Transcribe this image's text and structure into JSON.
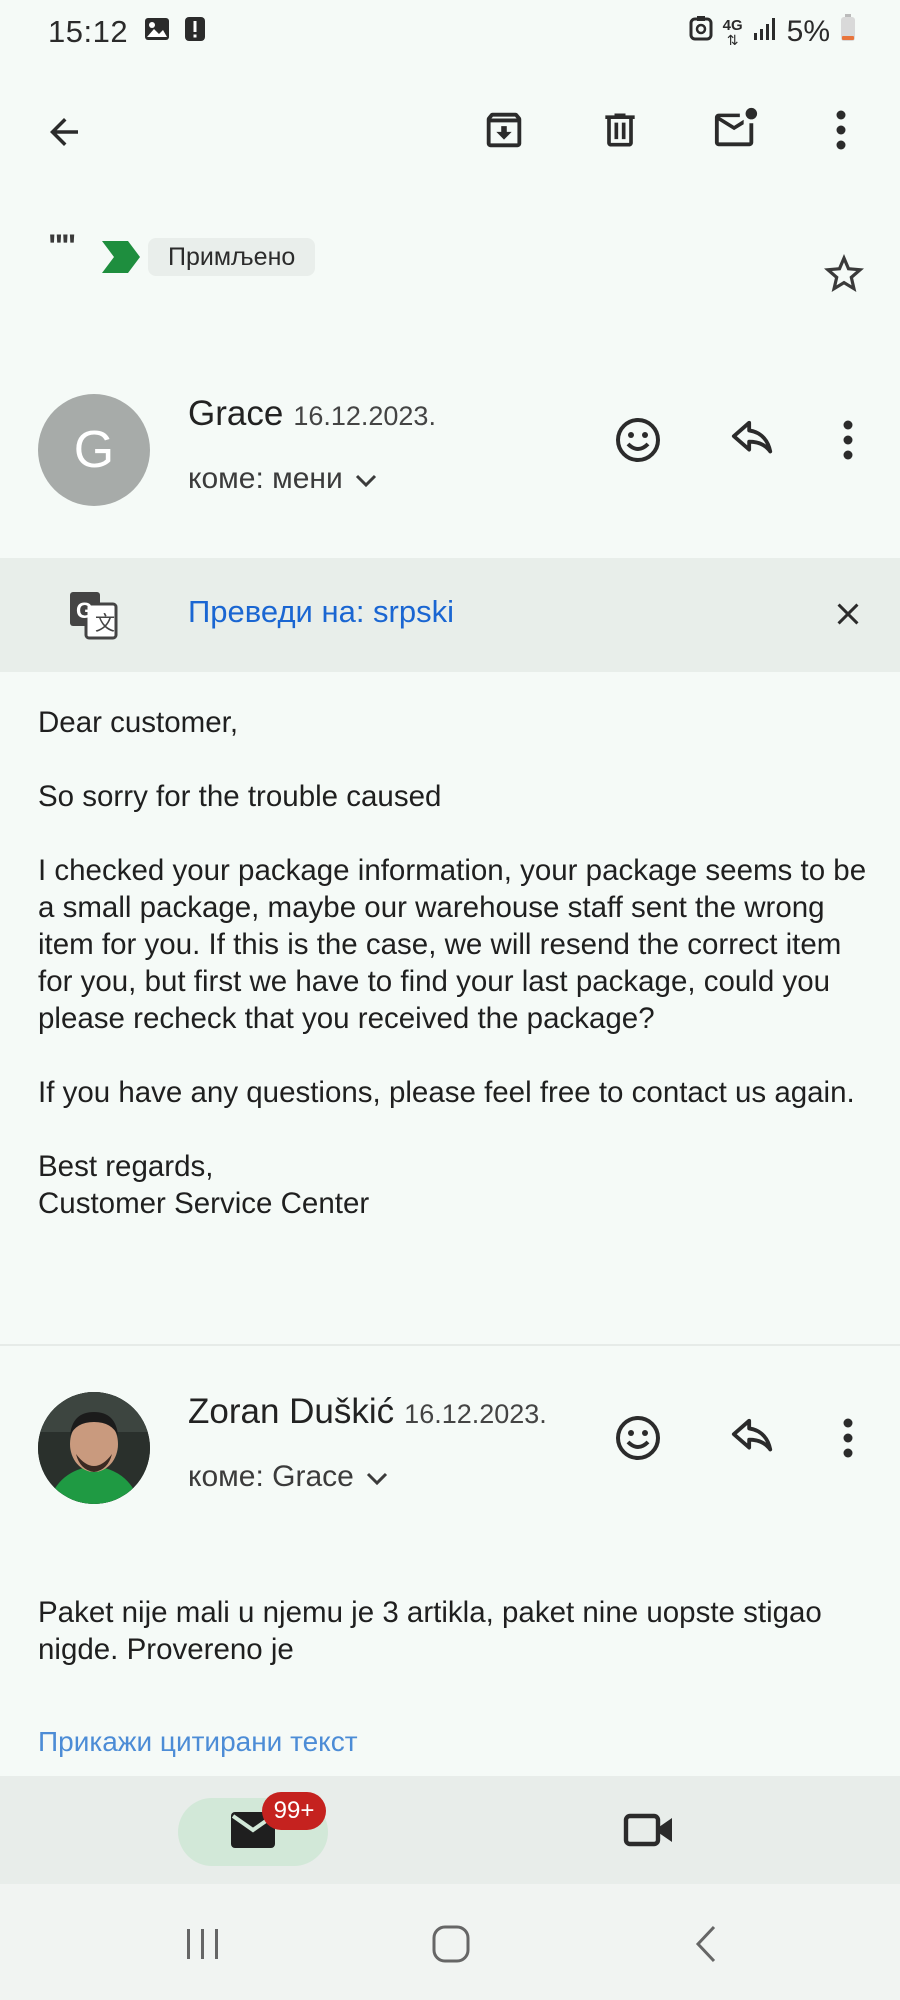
{
  "status_bar": {
    "time": "15:12",
    "network": "4G",
    "battery": "5%",
    "icons": [
      "image-icon",
      "alert-icon",
      "sync-icon",
      "network-4g-icon",
      "signal-icon",
      "battery-icon"
    ]
  },
  "toolbar": {
    "icons": [
      "back-arrow-icon",
      "archive-icon",
      "trash-icon",
      "mark-unread-icon",
      "more-vert-icon"
    ]
  },
  "thread": {
    "quote_marks": "\"\"",
    "label": "Примљено"
  },
  "message1": {
    "avatar_initial": "G",
    "sender": "Grace",
    "date": "16.12.2023.",
    "recipient": "коме: мени",
    "translate_label": "Преведи на: srpski",
    "body": {
      "greeting": "Dear customer,",
      "p1": "So sorry for the trouble caused",
      "p2": "I checked your package information, your package seems to be a small package, maybe our warehouse staff sent the wrong item for you. If this is the case, we will resend the correct item for you, but first we have to find your last package, could you please recheck that you received the package?",
      "p3": "If you have any questions, please feel free to contact us again.",
      "sign1": "Best regards,",
      "sign2": "Customer Service Center"
    }
  },
  "message2": {
    "sender": "Zoran Duškić",
    "date": "16.12.2023.",
    "recipient": "коме: Grace",
    "body": "Paket nije mali u njemu je 3 artikla, paket nine uopste stigao nigde. Provereno je",
    "show_quoted": "Прикажи цитирани текст"
  },
  "bottom_nav": {
    "badge": "99+"
  },
  "colors": {
    "background": "#f5faf7",
    "link": "#1a66d2",
    "badge": "#c5221f",
    "label_arrow": "#1e8e3e"
  }
}
